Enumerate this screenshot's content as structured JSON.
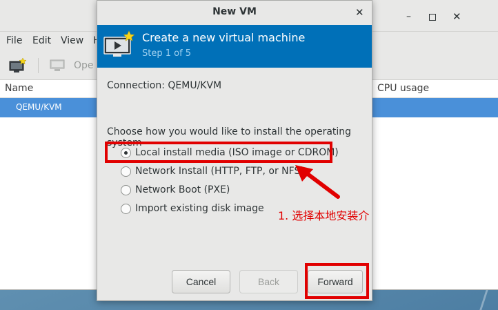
{
  "manager": {
    "window_controls": {
      "minimize": "–",
      "close": "✕"
    },
    "menu": [
      "File",
      "Edit",
      "View",
      "H"
    ],
    "toolbar": {
      "open_label": "Ope"
    },
    "columns": {
      "name": "Name",
      "cpu": "CPU usage"
    },
    "connection_row": "QEMU/KVM"
  },
  "dialog": {
    "title": "New VM",
    "close_glyph": "✕",
    "header": {
      "title": "Create a new virtual machine",
      "step": "Step 1 of 5"
    },
    "connection_text": "Connection:  QEMU/KVM",
    "prompt": "Choose how you would like to install the operating system",
    "options": [
      {
        "label": "Local install media (ISO image or CDROM)",
        "selected": true
      },
      {
        "label": "Network Install (HTTP, FTP, or NFS)",
        "selected": false
      },
      {
        "label": "Network Boot (PXE)",
        "selected": false
      },
      {
        "label": "Import existing disk image",
        "selected": false
      }
    ],
    "buttons": {
      "cancel": "Cancel",
      "back": "Back",
      "forward": "Forward"
    }
  },
  "annotation": {
    "text": "1. 选择本地安装介",
    "color": "#e10000"
  },
  "colors": {
    "header_blue": "#0070b8",
    "selection_blue": "#4a90d9",
    "highlight_red": "#e10000"
  }
}
